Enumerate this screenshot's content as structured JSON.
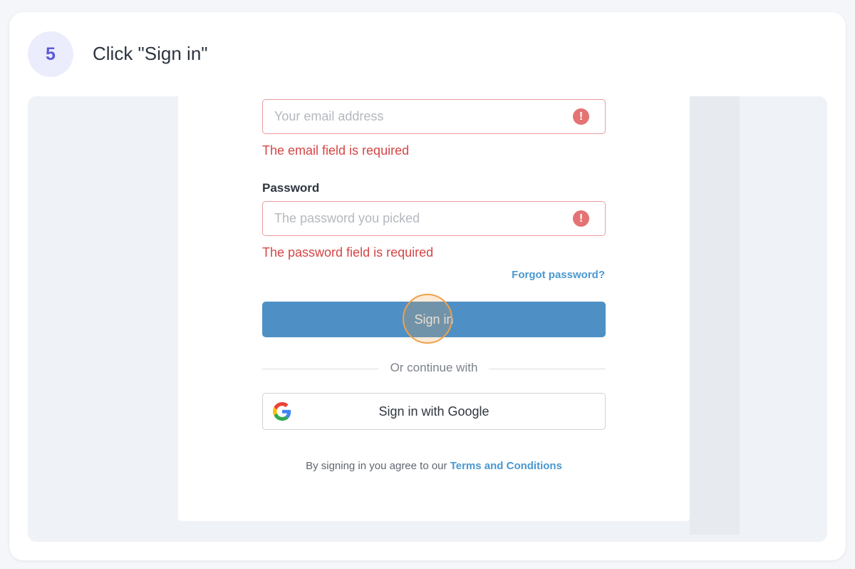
{
  "step": {
    "number": "5",
    "title": "Click \"Sign in\""
  },
  "form": {
    "email": {
      "placeholder": "Your email address",
      "error": "The email field is required",
      "icon": "error-icon"
    },
    "password": {
      "label": "Password",
      "placeholder": "The password you picked",
      "error": "The password field is required",
      "icon": "error-icon"
    },
    "forgot_label": "Forgot password?",
    "signin_label": "Sign in",
    "divider_label": "Or continue with",
    "google_label": "Sign in with Google",
    "terms_prefix": "By signing in you agree to our",
    "terms_link": "Terms and Conditions"
  },
  "colors": {
    "accent": "#5b5bd6",
    "primary_button": "#4e90c5",
    "error": "#d64545",
    "link": "#4a98d0",
    "click_highlight": "#f0a04b"
  }
}
